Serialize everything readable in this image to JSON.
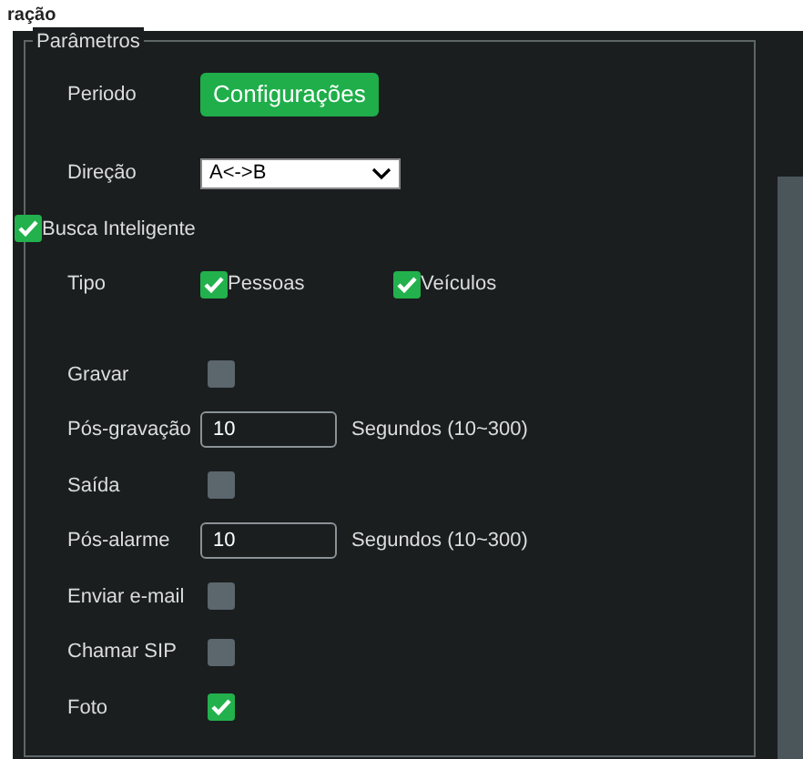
{
  "header": {
    "title": "ração"
  },
  "fieldset": {
    "legend": "Parâmetros"
  },
  "rows": [
    {
      "kind": "button",
      "label": "Periodo",
      "button": "Configurações"
    },
    {
      "kind": "select",
      "label": "Direção",
      "value": "A<->B"
    },
    {
      "kind": "master",
      "label": "Busca Inteligente",
      "checked": true
    },
    {
      "kind": "checks",
      "label": "Tipo",
      "options": [
        {
          "label": "Pessoas",
          "checked": true
        },
        {
          "label": "Veículos",
          "checked": true
        }
      ]
    },
    {
      "kind": "toggle",
      "label": "Gravar",
      "checked": false
    },
    {
      "kind": "number",
      "label": "Pós-gravação",
      "value": "10",
      "unit": "Segundos (10~300)"
    },
    {
      "kind": "toggle",
      "label": "Saída",
      "checked": false
    },
    {
      "kind": "number",
      "label": "Pós-alarme",
      "value": "10",
      "unit": "Segundos (10~300)"
    },
    {
      "kind": "toggle",
      "label": "Enviar e-mail",
      "checked": false
    },
    {
      "kind": "toggle",
      "label": "Chamar SIP",
      "checked": false
    },
    {
      "kind": "toggle",
      "label": "Foto",
      "checked": true
    }
  ]
}
